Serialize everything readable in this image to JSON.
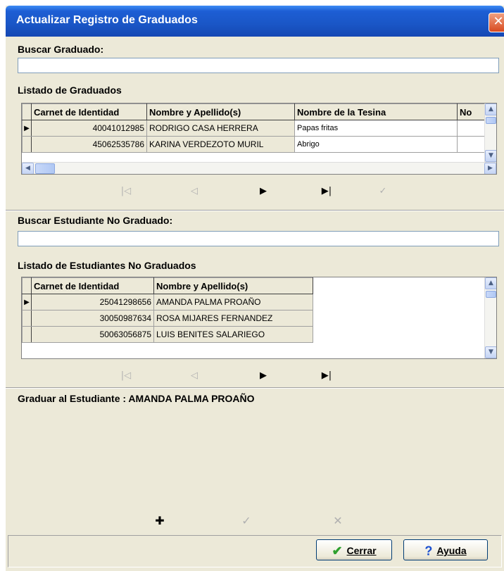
{
  "window": {
    "title": "Actualizar Registro de Graduados",
    "close_glyph": "✕"
  },
  "search_graduate": {
    "label": "Buscar Graduado:",
    "value": ""
  },
  "graduates": {
    "label": "Listado de Graduados",
    "columns": [
      "Carnet de Identidad",
      "Nombre y Apellido(s)",
      "Nombre de la Tesina",
      "No"
    ],
    "rows": [
      {
        "current": "▶",
        "carnet": "40041012985",
        "nombre": "RODRIGO CASA HERRERA",
        "tesina": "Papas fritas",
        "no": ""
      },
      {
        "current": "",
        "carnet": "45062535786",
        "nombre": "KARINA VERDEZOTO MURIL",
        "tesina": "Abrigo",
        "no": ""
      }
    ],
    "nav": {
      "first": "|◁",
      "prev": "◁",
      "next": "▶",
      "last": "▶|",
      "confirm": "✓"
    }
  },
  "search_student": {
    "label": "Buscar Estudiante No Graduado:",
    "value": ""
  },
  "students": {
    "label": "Listado de Estudiantes No Graduados",
    "columns": [
      "Carnet de Identidad",
      "Nombre y Apellido(s)"
    ],
    "rows": [
      {
        "current": "▶",
        "carnet": "25041298656",
        "nombre": "AMANDA PALMA PROAÑO"
      },
      {
        "current": "",
        "carnet": "30050987634",
        "nombre": "ROSA MIJARES FERNANDEZ"
      },
      {
        "current": "",
        "carnet": "50063056875",
        "nombre": "LUIS BENITES SALARIEGO"
      }
    ],
    "nav": {
      "first": "|◁",
      "prev": "◁",
      "next": "▶",
      "last": "▶|"
    }
  },
  "graduate_section": {
    "label": "Graduar al Estudiante : AMANDA PALMA PROAÑO",
    "actions": {
      "add": "✚",
      "confirm": "✓",
      "cancel": "✕"
    }
  },
  "footer": {
    "close_label": "Cerrar",
    "close_icon": "✔",
    "help_label": "Ayuda",
    "help_icon": "?"
  },
  "colors": {
    "title_bar": "#1d5ed4",
    "face": "#ece9d8",
    "close_icon": "#2ea02e",
    "help_icon": "#1a4fd0"
  }
}
